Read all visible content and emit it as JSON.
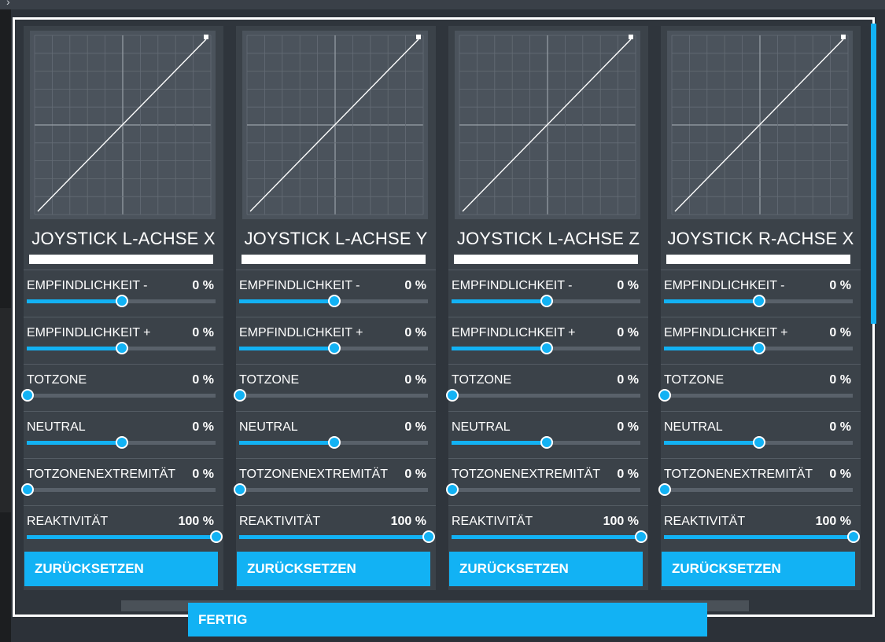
{
  "colors": {
    "accent": "#12b2f4",
    "panel": "#3b4249",
    "graph": "#4b535c",
    "frame": "#ffffff"
  },
  "panels": [
    {
      "title": "JOYSTICK L-ACHSE X",
      "settings": [
        {
          "label": "EMPFINDLICHKEIT -",
          "value": "0 %",
          "slider_fraction": 0.5
        },
        {
          "label": "EMPFINDLICHKEIT +",
          "value": "0 %",
          "slider_fraction": 0.5
        },
        {
          "label": "TOTZONE",
          "value": "0 %",
          "slider_fraction": 0.0
        },
        {
          "label": "NEUTRAL",
          "value": "0 %",
          "slider_fraction": 0.5
        },
        {
          "label": "TOTZONENEXTREMITÄT",
          "value": "0 %",
          "slider_fraction": 0.0
        },
        {
          "label": "REAKTIVITÄT",
          "value": "100 %",
          "slider_fraction": 1.0
        }
      ],
      "reset_label": "ZURÜCKSETZEN"
    },
    {
      "title": "JOYSTICK L-ACHSE Y",
      "settings": [
        {
          "label": "EMPFINDLICHKEIT -",
          "value": "0 %",
          "slider_fraction": 0.5
        },
        {
          "label": "EMPFINDLICHKEIT +",
          "value": "0 %",
          "slider_fraction": 0.5
        },
        {
          "label": "TOTZONE",
          "value": "0 %",
          "slider_fraction": 0.0
        },
        {
          "label": "NEUTRAL",
          "value": "0 %",
          "slider_fraction": 0.5
        },
        {
          "label": "TOTZONENEXTREMITÄT",
          "value": "0 %",
          "slider_fraction": 0.0
        },
        {
          "label": "REAKTIVITÄT",
          "value": "100 %",
          "slider_fraction": 1.0
        }
      ],
      "reset_label": "ZURÜCKSETZEN"
    },
    {
      "title": "JOYSTICK L-ACHSE Z",
      "settings": [
        {
          "label": "EMPFINDLICHKEIT -",
          "value": "0 %",
          "slider_fraction": 0.5
        },
        {
          "label": "EMPFINDLICHKEIT +",
          "value": "0 %",
          "slider_fraction": 0.5
        },
        {
          "label": "TOTZONE",
          "value": "0 %",
          "slider_fraction": 0.0
        },
        {
          "label": "NEUTRAL",
          "value": "0 %",
          "slider_fraction": 0.5
        },
        {
          "label": "TOTZONENEXTREMITÄT",
          "value": "0 %",
          "slider_fraction": 0.0
        },
        {
          "label": "REAKTIVITÄT",
          "value": "100 %",
          "slider_fraction": 1.0
        }
      ],
      "reset_label": "ZURÜCKSETZEN"
    },
    {
      "title": "JOYSTICK R-ACHSE X",
      "settings": [
        {
          "label": "EMPFINDLICHKEIT -",
          "value": "0 %",
          "slider_fraction": 0.5
        },
        {
          "label": "EMPFINDLICHKEIT +",
          "value": "0 %",
          "slider_fraction": 0.5
        },
        {
          "label": "TOTZONE",
          "value": "0 %",
          "slider_fraction": 0.0
        },
        {
          "label": "NEUTRAL",
          "value": "0 %",
          "slider_fraction": 0.5
        },
        {
          "label": "TOTZONENEXTREMITÄT",
          "value": "0 %",
          "slider_fraction": 0.0
        },
        {
          "label": "REAKTIVITÄT",
          "value": "100 %",
          "slider_fraction": 1.0
        }
      ],
      "reset_label": "ZURÜCKSETZEN"
    }
  ],
  "done_label": "FERTIG"
}
